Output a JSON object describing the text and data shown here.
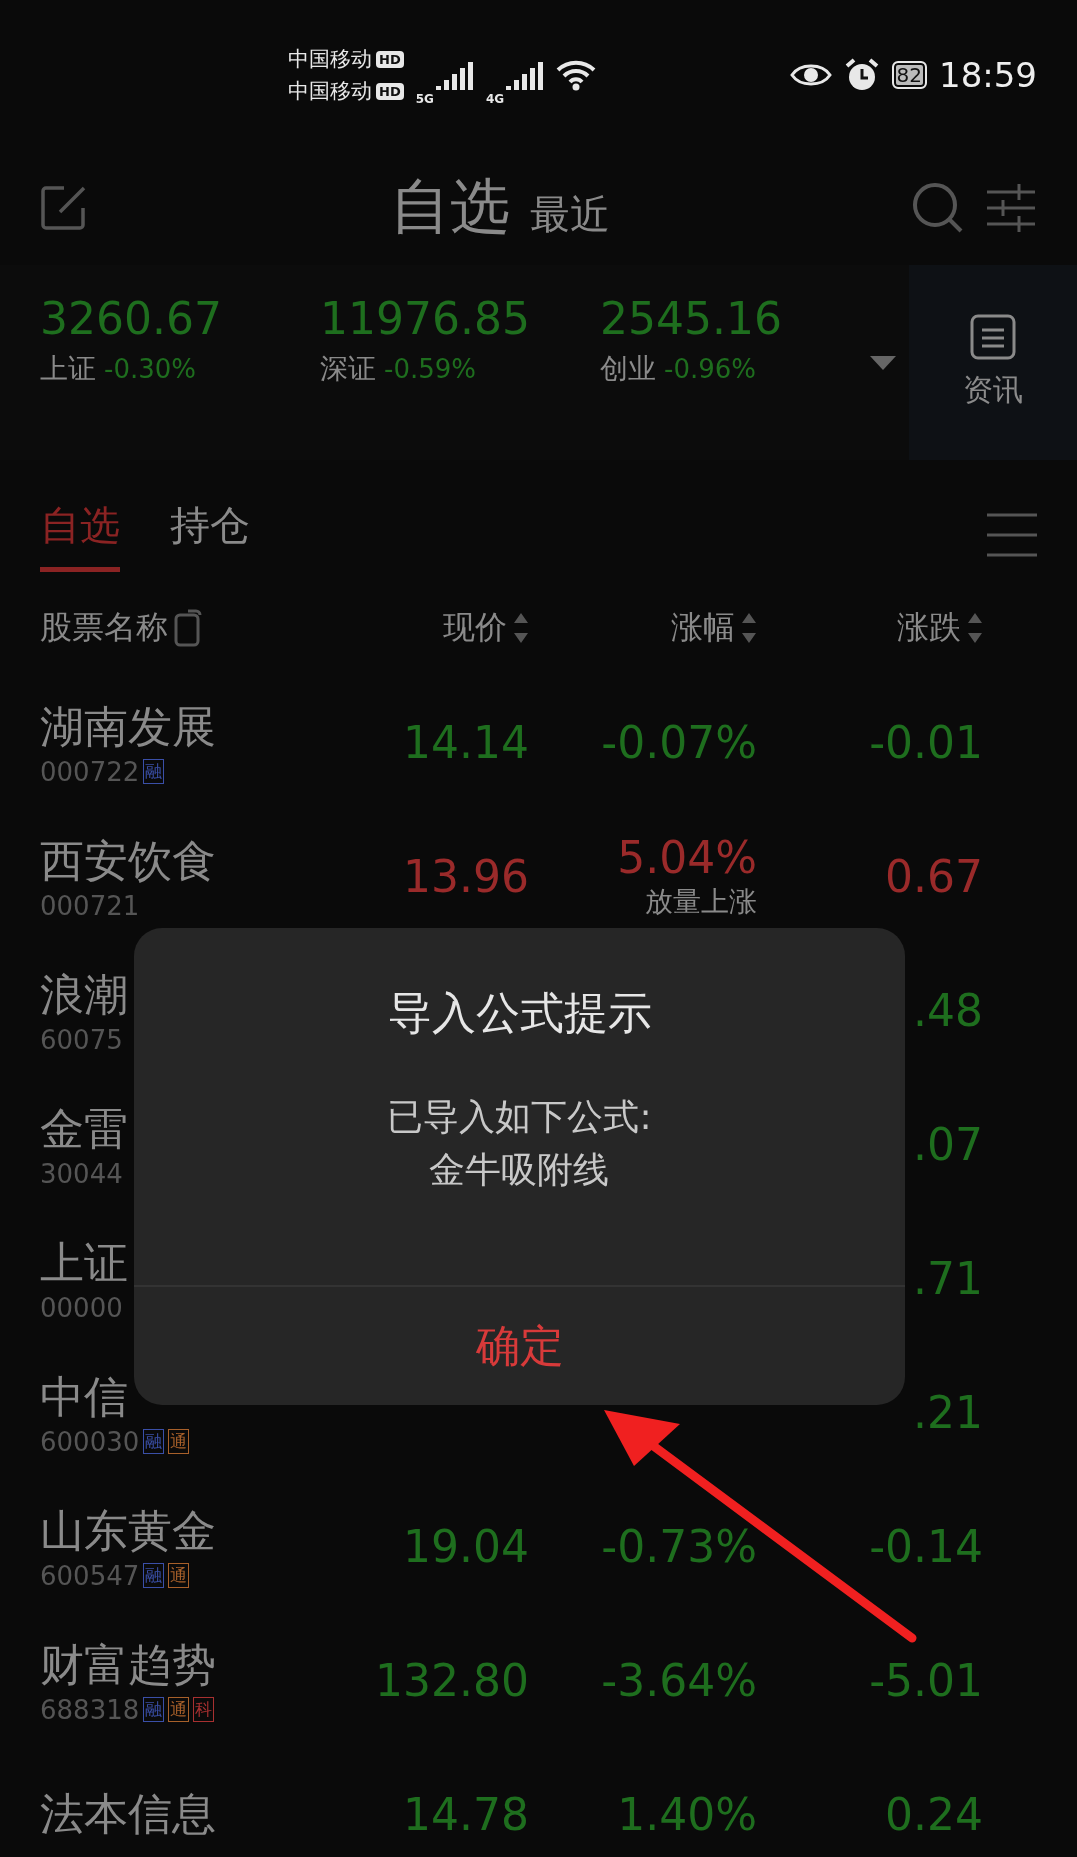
{
  "status_bar": {
    "carriers": [
      {
        "name": "中国移动",
        "badge": "HD"
      },
      {
        "name": "中国移动",
        "badge": "HD"
      }
    ],
    "networks": [
      "5G",
      "4G"
    ],
    "battery": "82",
    "time": "18:59"
  },
  "header": {
    "tabs": [
      {
        "label": "自选",
        "selected": true
      },
      {
        "label": "最近",
        "selected": false
      }
    ]
  },
  "indices": [
    {
      "value": "3260.67",
      "name": "上证",
      "change": "-0.30%"
    },
    {
      "value": "11976.85",
      "name": "深证",
      "change": "-0.59%"
    },
    {
      "value": "2545.16",
      "name": "创业",
      "change": "-0.96%"
    }
  ],
  "news_button": "资讯",
  "list_tabs": [
    {
      "label": "自选",
      "selected": true
    },
    {
      "label": "持仓",
      "selected": false
    }
  ],
  "columns": [
    "股票名称",
    "现价",
    "涨幅",
    "涨跌"
  ],
  "rows": [
    {
      "kind": "full",
      "name": "湖南发展",
      "code": "000722",
      "tags": [
        {
          "label": "融",
          "color": "#3a4fa8"
        }
      ],
      "price": "14.14",
      "change": "-0.07%",
      "diff": "-0.01",
      "color": "#1e6e1e"
    },
    {
      "kind": "full",
      "name": "西安饮食",
      "code": "000721",
      "price": "13.96",
      "change": "5.04%",
      "note": "放量上涨",
      "diff": "0.67",
      "color": "#9a2a2a"
    },
    {
      "kind": "covered",
      "name": "浪潮",
      "code": "60075",
      "diff": ".48",
      "color": "#1e6e1e"
    },
    {
      "kind": "covered",
      "name": "金雷",
      "code": "30044",
      "diff": ".07",
      "color": "#1e6e1e"
    },
    {
      "kind": "covered",
      "name": "上证",
      "code": "00000",
      "diff": ".71",
      "color": "#1e6e1e"
    },
    {
      "kind": "covered",
      "name": "中信",
      "code": "600030",
      "tags": [
        {
          "label": "融",
          "color": "#3a4fa8"
        },
        {
          "label": "通",
          "color": "#a8602a"
        }
      ],
      "diff": ".21",
      "color": "#1e6e1e"
    },
    {
      "kind": "full",
      "name": "山东黄金",
      "code": "600547",
      "tags": [
        {
          "label": "融",
          "color": "#3a4fa8"
        },
        {
          "label": "通",
          "color": "#a8602a"
        }
      ],
      "price": "19.04",
      "change": "-0.73%",
      "diff": "-0.14",
      "color": "#1e6e1e"
    },
    {
      "kind": "full",
      "name": "财富趋势",
      "code": "688318",
      "tags": [
        {
          "label": "融",
          "color": "#3a4fa8"
        },
        {
          "label": "通",
          "color": "#a8602a"
        },
        {
          "label": "科",
          "color": "#a83030"
        }
      ],
      "price": "132.80",
      "change": "-3.64%",
      "diff": "-5.01",
      "color": "#1e6e1e"
    },
    {
      "kind": "full",
      "name": "法本信息",
      "price": "14.78",
      "change": "1.40%",
      "diff": "0.24",
      "color": "#1e6e1e"
    }
  ],
  "dialog": {
    "title": "导入公式提示",
    "message": [
      "已导入如下公式:",
      "金牛吸附线"
    ],
    "button": "确定"
  }
}
